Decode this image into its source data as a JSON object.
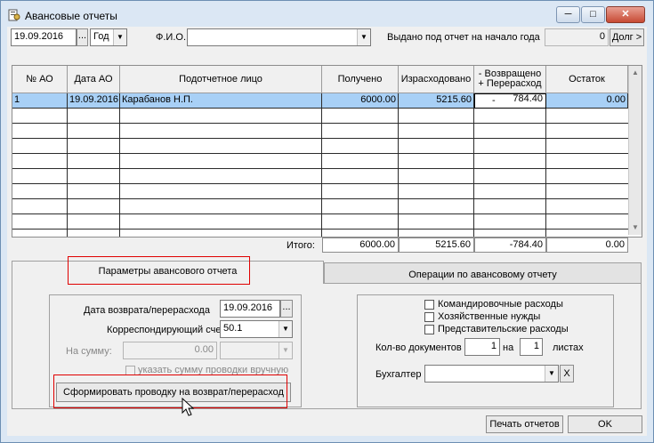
{
  "window": {
    "title": "Авансовые отчеты",
    "controls": {
      "minimize": "─",
      "maximize": "□",
      "close": "✕"
    }
  },
  "toolbar": {
    "date_value": "19.09.2016",
    "date_button": "...",
    "period_value": "Год",
    "fio_label": "Ф.И.О.",
    "fio_value": "",
    "issued_label": "Выдано под отчет на начало года",
    "issued_value": "0",
    "debt_button": "Долг >"
  },
  "table": {
    "columns": [
      "№ АО",
      "Дата АО",
      "Подотчетное лицо",
      "Получено",
      "Израсходовано",
      "- Возвращено\n+ Перерасход",
      "Остаток"
    ],
    "rows": [
      {
        "no": "1",
        "date": "19.09.2016",
        "person": "Карабанов Н.П.",
        "received": "6000.00",
        "spent": "5215.60",
        "returned_sign": "-",
        "returned": "784.40",
        "balance": "0.00"
      }
    ],
    "totals_label": "Итого:",
    "totals": {
      "received": "6000.00",
      "spent": "5215.60",
      "returned": "-784.40",
      "balance": "0.00"
    }
  },
  "tabs": {
    "params": "Параметры авансового отчета",
    "operations": "Операции по авансовому отчету"
  },
  "params": {
    "return_date_label": "Дата возврата/перерасхода",
    "return_date_value": "19.09.2016",
    "return_date_button": "...",
    "account_label": "Корреспондирующий счет",
    "account_value": "50.1",
    "amount_label": "На сумму:",
    "amount_value": "0.00",
    "amount_select_value": "",
    "manual_checkbox_label": "указать сумму проводки вручную",
    "create_button": "Сформировать проводку на возврат/перерасход"
  },
  "expenses": {
    "travel_label": "Командировочные расходы",
    "household_label": "Хозяйственные нужды",
    "representative_label": "Представительские расходы",
    "docs_label": "Кол-во документов",
    "docs_value": "1",
    "on_label": "на",
    "sheets_value": "1",
    "sheets_label": "листах",
    "accountant_label": "Бухгалтер",
    "accountant_value": "",
    "clear_button": "X"
  },
  "footer": {
    "print_button": "Печать отчетов",
    "ok_button": "OK"
  }
}
